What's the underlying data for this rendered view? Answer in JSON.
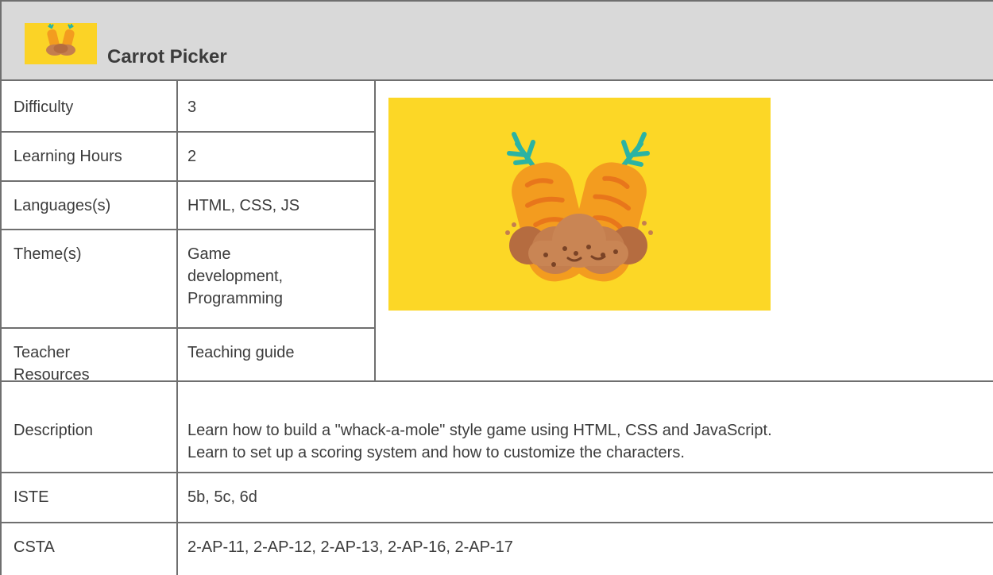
{
  "header": {
    "title": "Carrot Picker",
    "thumbnail_icon": "carrots-in-dirt-icon"
  },
  "rows": {
    "difficulty": {
      "label": "Difficulty",
      "value": "3"
    },
    "learning_hours": {
      "label": "Learning Hours",
      "value": "2"
    },
    "languages": {
      "label": "Languages(s)",
      "value": "HTML, CSS, JS"
    },
    "themes": {
      "label": "Theme(s)",
      "value_line1": "Game",
      "value_line2": "development,",
      "value_line3": "Programming"
    },
    "teacher_resources": {
      "label_line1": "Teacher",
      "label_line2": "Resources",
      "value": "Teaching guide"
    },
    "description": {
      "label": "Description",
      "value_line1": "Learn how to build a \"whack-a-mole\" style game using HTML, CSS and JavaScript.",
      "value_line2": "Learn to set up a scoring system and how to customize the characters."
    },
    "iste": {
      "label": "ISTE",
      "value": "5b, 5c, 6d"
    },
    "csta": {
      "label": "CSTA",
      "value": "2-AP-11, 2-AP-12, 2-AP-13, 2-AP-16, 2-AP-17"
    }
  },
  "hero_image": {
    "icon": "carrots-in-dirt-illustration",
    "background": "#fcd726"
  },
  "colors": {
    "header_bg": "#d9d9d9",
    "border": "#6f6f6f",
    "text": "#3c3c3c",
    "carrot_orange": "#f39c1f",
    "carrot_stripe": "#e8761b",
    "leaf_teal": "#2bb3a3",
    "dirt_brown": "#c47e4e"
  }
}
